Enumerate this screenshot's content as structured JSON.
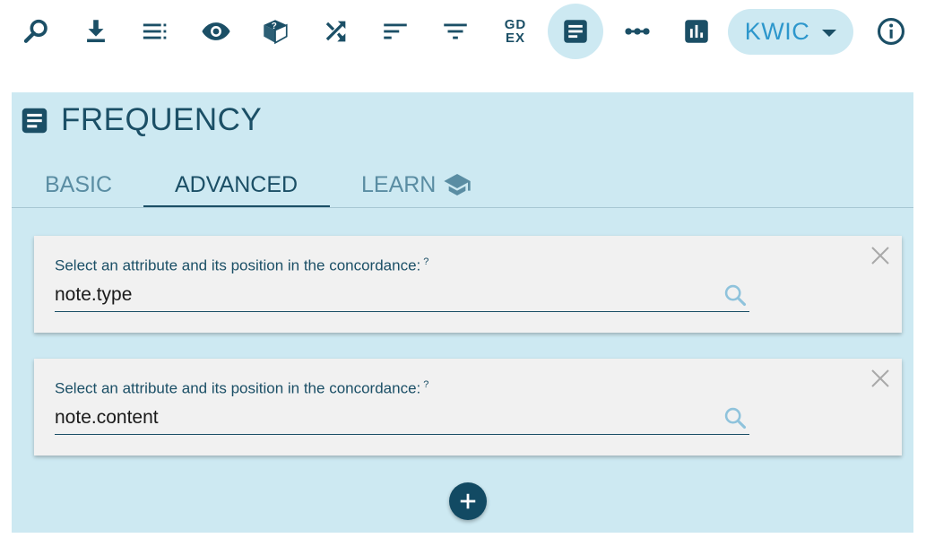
{
  "toolbar": {
    "icons": [
      "search-icon",
      "download-icon",
      "view-list-icon",
      "eye-icon",
      "cube-question-icon",
      "shuffle-icon",
      "sort-icon",
      "filter-icon",
      "gdex-icon",
      "frequency-icon",
      "collocations-icon",
      "bar-chart-icon",
      "info-icon"
    ],
    "gdex_line1": "GD",
    "gdex_line2": "EX",
    "kwic_label": "KWIC",
    "active_tool": "frequency"
  },
  "panel": {
    "title": "FREQUENCY",
    "tabs": [
      {
        "label": "BASIC",
        "active": false
      },
      {
        "label": "ADVANCED",
        "active": true
      },
      {
        "label": "LEARN",
        "active": false
      }
    ],
    "criteria": [
      {
        "label": "Select an attribute and its position in the concordance:",
        "help": "?",
        "value": "note.type"
      },
      {
        "label": "Select an attribute and its position in the concordance:",
        "help": "?",
        "value": "note.content"
      }
    ]
  },
  "colors": {
    "primary": "#1b4f66",
    "accent": "#2d97cc",
    "panel_bg": "#cde9f2",
    "card_bg": "#f1f1f1",
    "add_button": "#124a63"
  }
}
